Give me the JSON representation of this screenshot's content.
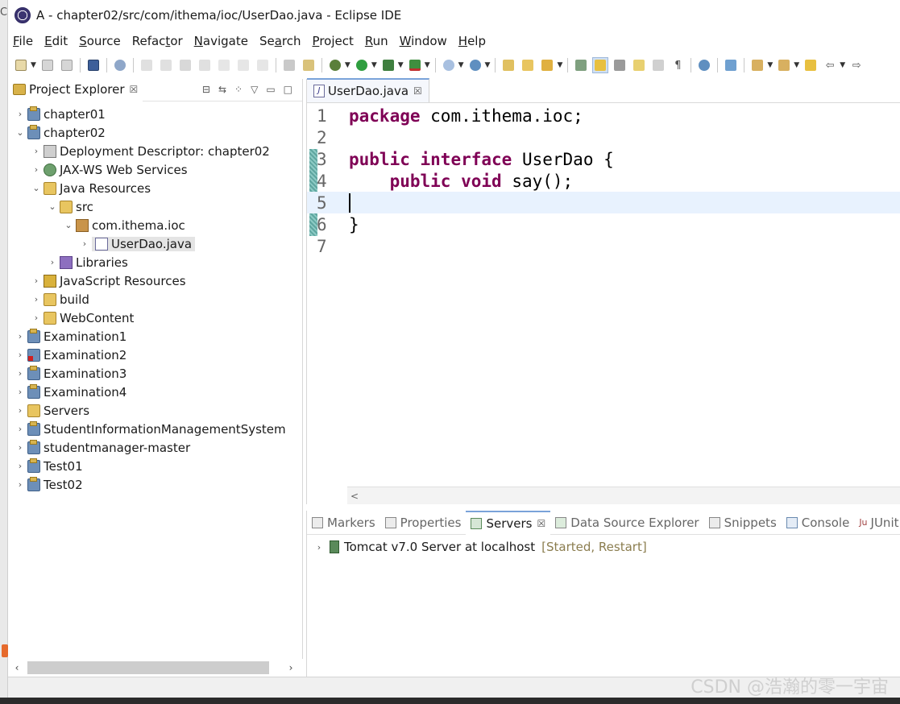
{
  "window": {
    "title": "A - chapter02/src/com/ithema/ioc/UserDao.java - Eclipse IDE",
    "left_edge_text": "C"
  },
  "menu": {
    "items": [
      {
        "label_u": "F",
        "label_rest": "ile"
      },
      {
        "label_u": "E",
        "label_rest": "dit"
      },
      {
        "label_u": "S",
        "label_rest": "ource"
      },
      {
        "label_pre": "Refac",
        "label_u": "t",
        "label_rest": "or"
      },
      {
        "label_u": "N",
        "label_rest": "avigate"
      },
      {
        "label_pre": "Se",
        "label_u": "a",
        "label_rest": "rch"
      },
      {
        "label_u": "P",
        "label_rest": "roject"
      },
      {
        "label_u": "R",
        "label_rest": "un"
      },
      {
        "label_u": "W",
        "label_rest": "indow"
      },
      {
        "label_u": "H",
        "label_rest": "elp"
      }
    ]
  },
  "explorer": {
    "tab_label": "Project Explorer",
    "close_glyph": "☒",
    "tree": [
      {
        "label": "chapter01"
      },
      {
        "label": "chapter02"
      },
      {
        "label": "Deployment Descriptor: chapter02"
      },
      {
        "label": "JAX-WS Web Services"
      },
      {
        "label": "Java Resources"
      },
      {
        "label": "src"
      },
      {
        "label": "com.ithema.ioc"
      },
      {
        "label": "UserDao.java"
      },
      {
        "label": "Libraries"
      },
      {
        "label": "JavaScript Resources"
      },
      {
        "label": "build"
      },
      {
        "label": "WebContent"
      },
      {
        "label": "Examination1"
      },
      {
        "label": "Examination2"
      },
      {
        "label": "Examination3"
      },
      {
        "label": "Examination4"
      },
      {
        "label": "Servers"
      },
      {
        "label": "StudentInformationManagementSystem"
      },
      {
        "label": "studentmanager-master"
      },
      {
        "label": "Test01"
      },
      {
        "label": "Test02"
      }
    ]
  },
  "editor": {
    "tab_label": "UserDao.java",
    "tab_close": "☒",
    "jicon": "J",
    "line_numbers": [
      "1",
      "2",
      "3",
      "4",
      "5",
      "6",
      "7"
    ],
    "code": {
      "l1_kw": "package",
      "l1_rest": " com.ithema.ioc;",
      "l3_kw1": "public",
      "l3_kw2": "interface",
      "l3_rest": " UserDao {",
      "l4_indent": "    ",
      "l4_kw1": "public",
      "l4_kw2": "void",
      "l4_rest": " say();",
      "l6": "}"
    },
    "scroll_left": "<"
  },
  "bottom_panel": {
    "tabs": [
      {
        "label": "Markers"
      },
      {
        "label": "Properties"
      },
      {
        "label": "Servers",
        "close": "☒"
      },
      {
        "label": "Data Source Explorer"
      },
      {
        "label": "Snippets"
      },
      {
        "label": "Console"
      },
      {
        "label": "JUnit",
        "prefix": "Ju"
      }
    ],
    "server": {
      "name": "Tomcat v7.0 Server at localhost",
      "status": "[Started, Restart]"
    }
  },
  "watermark": "CSDN @浩瀚的零一宇宙"
}
